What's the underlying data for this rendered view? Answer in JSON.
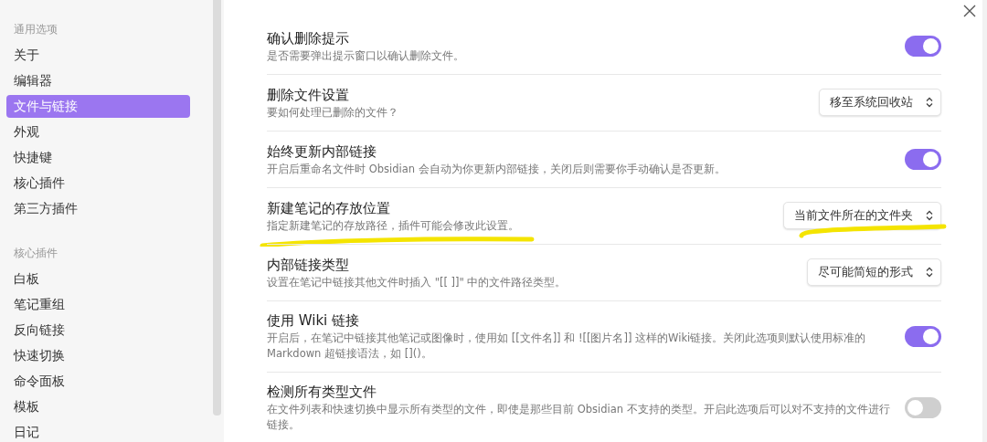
{
  "sidebar": {
    "sections": [
      {
        "heading": "通用选项",
        "items": [
          {
            "label": "关于",
            "selected": false
          },
          {
            "label": "编辑器",
            "selected": false
          },
          {
            "label": "文件与链接",
            "selected": true
          },
          {
            "label": "外观",
            "selected": false
          },
          {
            "label": "快捷键",
            "selected": false
          },
          {
            "label": "核心插件",
            "selected": false
          },
          {
            "label": "第三方插件",
            "selected": false
          }
        ]
      },
      {
        "heading": "核心插件",
        "items": [
          {
            "label": "白板",
            "selected": false
          },
          {
            "label": "笔记重组",
            "selected": false
          },
          {
            "label": "反向链接",
            "selected": false
          },
          {
            "label": "快速切换",
            "selected": false
          },
          {
            "label": "命令面板",
            "selected": false
          },
          {
            "label": "模板",
            "selected": false
          },
          {
            "label": "日记",
            "selected": false
          }
        ]
      }
    ]
  },
  "settings": [
    {
      "title": "确认删除提示",
      "description": "是否需要弹出提示窗口以确认删除文件。",
      "kind": "toggle",
      "on": true,
      "highlighted": false
    },
    {
      "title": "删除文件设置",
      "description": "要如何处理已删除的文件？",
      "kind": "dropdown",
      "value": "移至系统回收站",
      "highlighted": false
    },
    {
      "title": "始终更新内部链接",
      "description": "开启后重命名文件时 Obsidian 会自动为你更新内部链接，关闭后则需要你手动确认是否更新。",
      "kind": "toggle",
      "on": true,
      "highlighted": false
    },
    {
      "title": "新建笔记的存放位置",
      "description": "指定新建笔记的存放路径，插件可能会修改此设置。",
      "kind": "dropdown",
      "value": "当前文件所在的文件夹",
      "highlighted": true
    },
    {
      "title": "内部链接类型",
      "description": "设置在笔记中链接其他文件时插入 \"[[ ]]\" 中的文件路径类型。",
      "kind": "dropdown",
      "value": "尽可能简短的形式",
      "highlighted": false
    },
    {
      "title": "使用 Wiki 链接",
      "description": "开启后，在笔记中链接其他笔记或图像时，使用如 [[文件名]] 和 ![[图片名]] 这样的Wiki链接。关闭此选项则默认使用标准的 Markdown 超链接语法，如 []()。",
      "kind": "toggle",
      "on": true,
      "highlighted": false
    },
    {
      "title": "检测所有类型文件",
      "description": "在文件列表和快速切换中显示所有类型的文件，即使是那些目前 Obsidian 不支持的类型。开启此选项后可以对不支持的文件进行链接。",
      "kind": "toggle",
      "on": false,
      "highlighted": false
    }
  ]
}
